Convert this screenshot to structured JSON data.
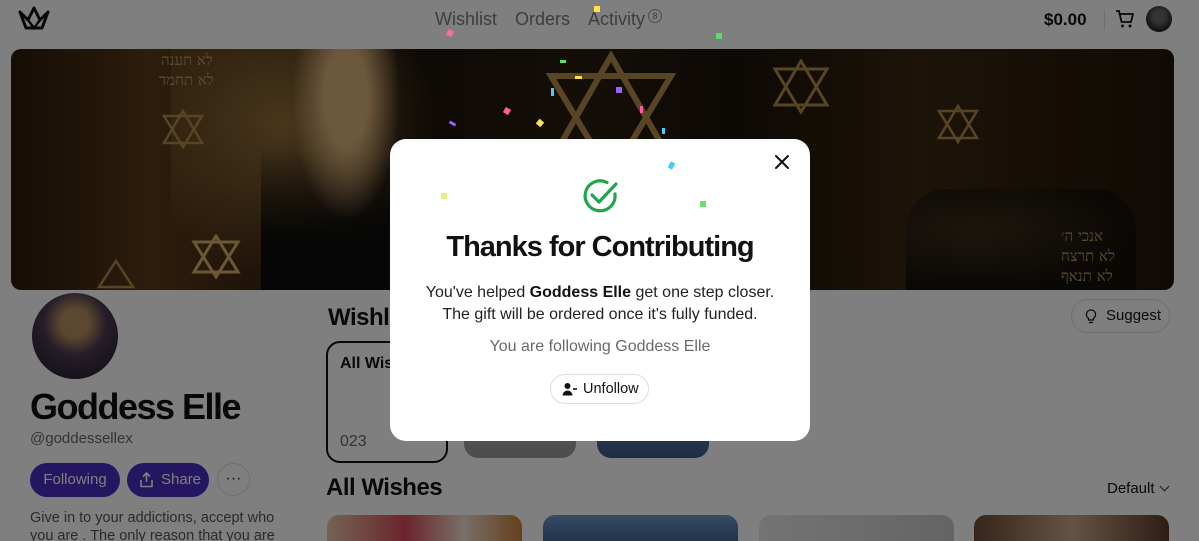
{
  "nav": {
    "links": [
      "Wishlist",
      "Orders",
      "Activity"
    ],
    "activity_count": "8",
    "balance": "$0.00"
  },
  "banner": {
    "hebrew_1": "לא תענה",
    "hebrew_2": "לא תחמד",
    "hebrew_3": "אנכי ה׳",
    "hebrew_4": "לא תרצח",
    "hebrew_5": "לא תנאף"
  },
  "profile": {
    "name": "Goddess Elle",
    "handle": "@goddessellex",
    "following_label": "Following",
    "share_label": "Share",
    "more_label": "···",
    "bio": "Give in to your addictions, accept who you are . The only reason that you are"
  },
  "wishlist": {
    "title": "Wishli",
    "suggest_label": "Suggest",
    "all_card_label": "All Wis",
    "all_card_count": "023"
  },
  "all_wishes": {
    "title": "All Wishes",
    "sort_label": "Default"
  },
  "modal": {
    "title": "Thanks for Contributing",
    "msg_prefix": "You've helped ",
    "msg_name": "Goddess Elle",
    "msg_suffix": " get one step closer.",
    "msg_line2": "The gift will be ordered once it's fully funded.",
    "following_text": "You are following Goddess Elle",
    "unfollow_label": "Unfollow"
  },
  "colors": {
    "primary": "#4a2cc2",
    "check_green": "#1fa64a"
  }
}
